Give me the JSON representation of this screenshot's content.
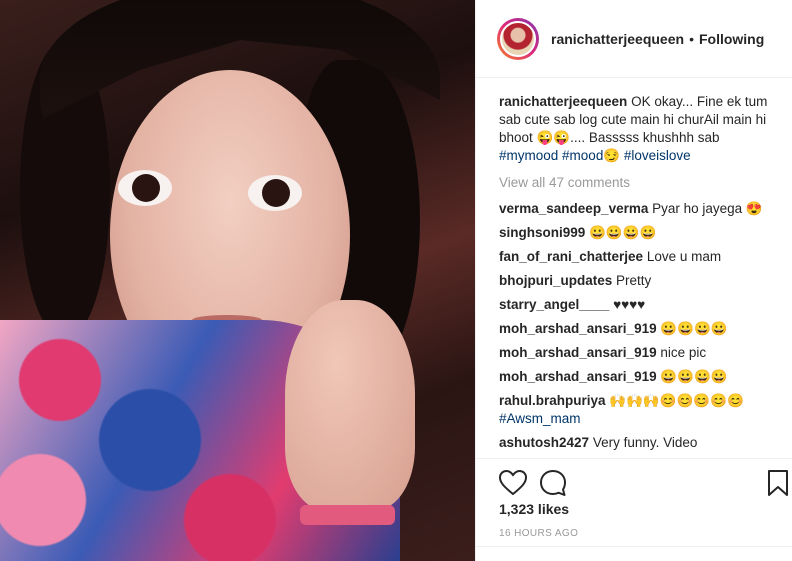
{
  "post": {
    "username": "ranichatterjeequeen",
    "separator": "•",
    "follow_status": "Following",
    "caption": {
      "text": "OK okay... Fine ek tum sab cute sab log cute main hi churAil main hi bhoot 😜😜.... Basssss khushhh sab ",
      "hashtags": [
        "#mymood",
        "#mood😏",
        "#loveislove"
      ]
    },
    "view_all_comments": "View all 47 comments",
    "comments": [
      {
        "user": "verma_sandeep_verma",
        "text": "Pyar ho jayega 😍"
      },
      {
        "user": "singhsoni999",
        "text": "😀😀😀😀"
      },
      {
        "user": "fan_of_rani_chatterjee",
        "text": "Love u mam"
      },
      {
        "user": "bhojpuri_updates",
        "text": "Pretty"
      },
      {
        "user": "starry_angel____",
        "text": "♥♥♥♥"
      },
      {
        "user": "moh_arshad_ansari_919",
        "text": "😀😀😀😀"
      },
      {
        "user": "moh_arshad_ansari_919",
        "text": "nice pic"
      },
      {
        "user": "moh_arshad_ansari_919",
        "text": "😀😀😀😀"
      },
      {
        "user": "rahul.brahpuriya",
        "text": "🙌🙌🙌😊😊😊😊😊",
        "tag": "#Awsm_mam"
      },
      {
        "user": "ashutosh2427",
        "text": "Very funny. Video"
      }
    ],
    "likes": "1,323 likes",
    "timestamp": "16 HOURS AGO",
    "icons": {
      "like": "heart-icon",
      "comment": "comment-bubble-icon",
      "save": "bookmark-icon"
    }
  }
}
